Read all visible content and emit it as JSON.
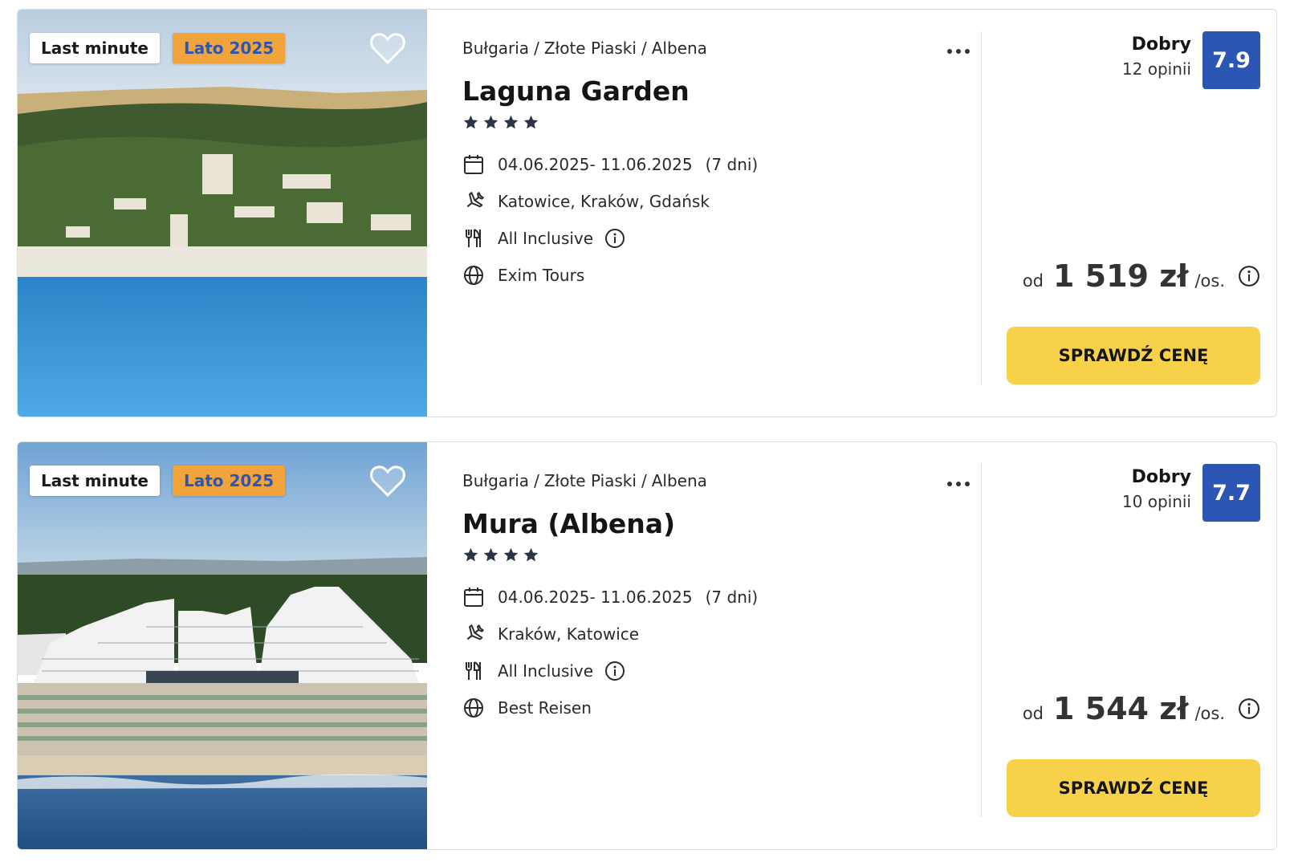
{
  "colors": {
    "score_bg": "#2b56b3",
    "season_badge_bg": "#f1a33c",
    "season_badge_text": "#2b56b3",
    "cta_bg": "#f7d14a"
  },
  "offers": [
    {
      "badges": {
        "last_minute": "Last minute",
        "season": "Lato 2025"
      },
      "breadcrumb": {
        "country": "Bułgaria",
        "region": "Złote Piaski",
        "city": "Albena",
        "separator": "/"
      },
      "name": "Laguna Garden",
      "stars": 4,
      "dates": "04.06.2025- 11.06.2025",
      "duration": "(7 dni)",
      "departures": "Katowice, Kraków, Gdańsk",
      "board": "All Inclusive",
      "operator": "Exim Tours",
      "rating_label": "Dobry",
      "reviews": "12 opinii",
      "score": "7.9",
      "price_prefix": "od",
      "price": "1 519 zł",
      "price_unit": "/os.",
      "cta": "SPRAWDŹ CENĘ",
      "photo_icon": "resort-aerial-photo"
    },
    {
      "badges": {
        "last_minute": "Last minute",
        "season": "Lato 2025"
      },
      "breadcrumb": {
        "country": "Bułgaria",
        "region": "Złote Piaski",
        "city": "Albena",
        "separator": "/"
      },
      "name": "Mura (Albena)",
      "stars": 4,
      "dates": "04.06.2025- 11.06.2025",
      "duration": "(7 dni)",
      "departures": "Kraków, Katowice",
      "board": "All Inclusive",
      "operator": "Best Reisen",
      "rating_label": "Dobry",
      "reviews": "10 opinii",
      "score": "7.7",
      "price_prefix": "od",
      "price": "1 544 zł",
      "price_unit": "/os.",
      "cta": "SPRAWDŹ CENĘ",
      "photo_icon": "hotel-beach-photo"
    }
  ]
}
